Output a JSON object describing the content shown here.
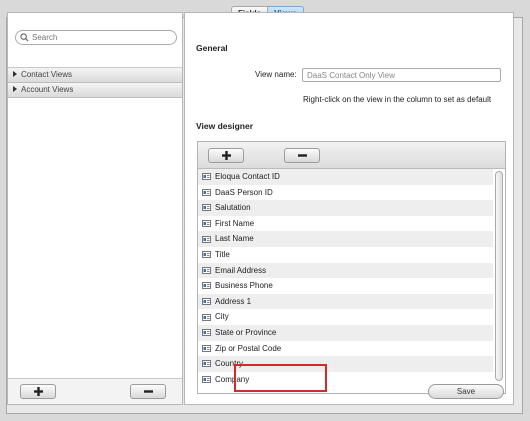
{
  "tabs": [
    {
      "label": "Fields",
      "active": false
    },
    {
      "label": "Views",
      "active": true
    }
  ],
  "sidebar": {
    "search_placeholder": "Search",
    "groups": [
      {
        "label": "Contact Views"
      },
      {
        "label": "Account Views"
      }
    ]
  },
  "main": {
    "general_heading": "General",
    "view_name_label": "View name:",
    "view_name_value": "DaaS Contact Only View",
    "hint": "Right-click on the view in the column to set as default",
    "designer_heading": "View designer",
    "fields": [
      "Eloqua Contact ID",
      "DaaS Person ID",
      "Salutation",
      "First Name",
      "Last Name",
      "Title",
      "Email Address",
      "Business Phone",
      "Address 1",
      "City",
      "State or Province",
      "Zip or Postal Code",
      "Country",
      "Company"
    ],
    "save_label": "Save"
  },
  "colors": {
    "highlight": "#d9282a",
    "active_tab": "#9ccbee"
  }
}
